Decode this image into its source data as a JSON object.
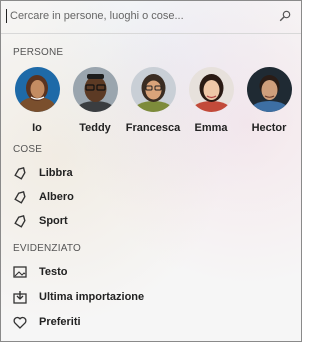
{
  "search": {
    "placeholder": "Cercare in persone, luoghi o cose...",
    "icon": "search-icon"
  },
  "sections": {
    "people_title": "PERSONE",
    "things_title": "COSE",
    "highlight_title": "EVIDENZIATO"
  },
  "people": [
    {
      "name": "Io"
    },
    {
      "name": "Teddy"
    },
    {
      "name": "Francesca"
    },
    {
      "name": "Emma"
    },
    {
      "name": "Hector"
    }
  ],
  "things": [
    {
      "label": "Libbra",
      "icon": "tag-icon"
    },
    {
      "label": "Albero",
      "icon": "tag-icon"
    },
    {
      "label": "Sport",
      "icon": "tag-icon"
    }
  ],
  "highlights": [
    {
      "label": "Testo",
      "icon": "image-icon"
    },
    {
      "label": "Ultima importazione",
      "icon": "import-icon"
    },
    {
      "label": "Preferiti",
      "icon": "heart-icon"
    }
  ]
}
